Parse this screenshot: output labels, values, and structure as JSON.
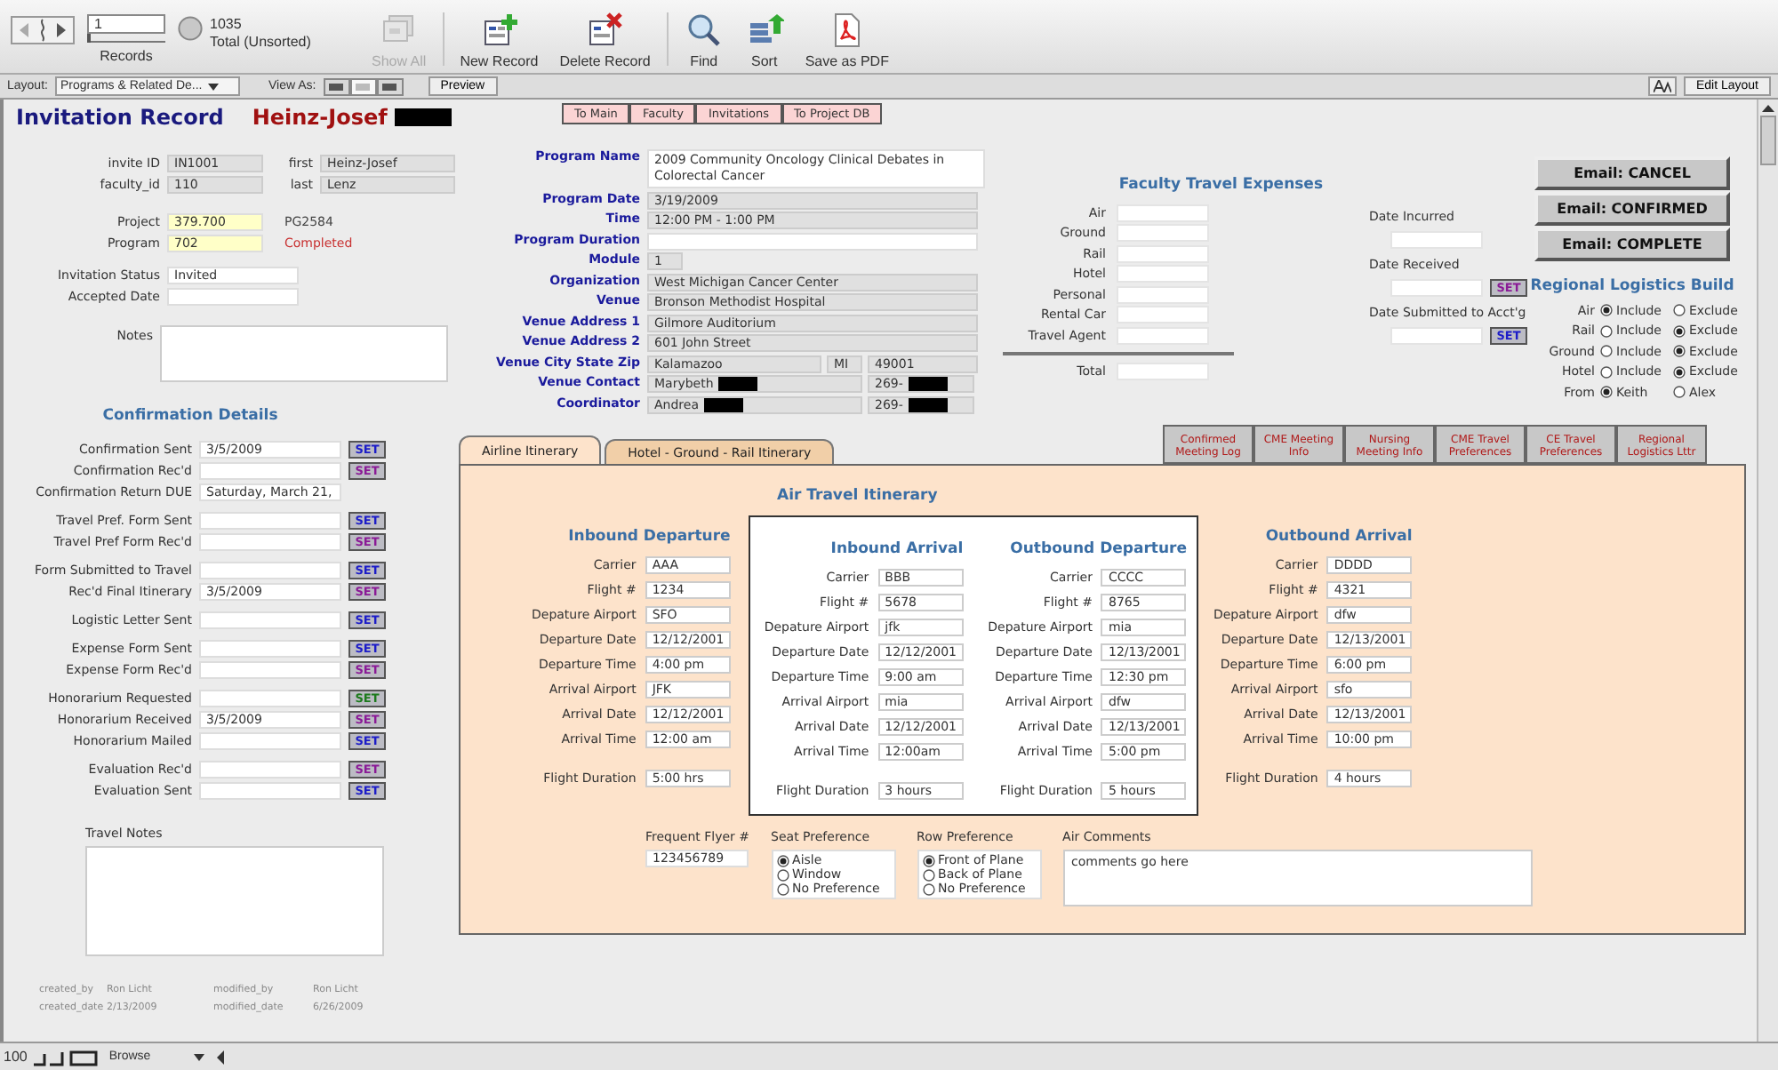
{
  "toolbar": {
    "record_number": "1",
    "record_slider": {
      "level": 0
    },
    "records_label": "Records",
    "found_count": "1035",
    "total_label": "Total (Unsorted)",
    "buttons": [
      {
        "kind": "show_all",
        "label": "Show All",
        "disabled": true
      },
      {
        "kind": "new",
        "label": "New Record",
        "disabled": false
      },
      {
        "kind": "delete",
        "label": "Delete Record",
        "disabled": false
      },
      {
        "kind": "find",
        "label": "Find",
        "disabled": false
      },
      {
        "kind": "sort",
        "label": "Sort",
        "disabled": false
      },
      {
        "kind": "pdf",
        "label": "Save as PDF",
        "disabled": false
      }
    ]
  },
  "layout_bar": {
    "layout_label": "Layout:",
    "layout_value": "Programs & Related De...",
    "view_as_label": "View As:",
    "view_modes": [
      {
        "selected": false
      },
      {
        "selected": true
      },
      {
        "selected": false
      }
    ],
    "preview_button": "Preview",
    "edit_layout_button": "Edit Layout"
  },
  "header": {
    "title": "Invitation Record",
    "name": "Heinz-Josef",
    "redacted": true
  },
  "nav_buttons": [
    "To Main",
    "Faculty",
    "Invitations",
    "To Project DB"
  ],
  "id_rows": [
    {
      "label": "invite ID",
      "value": "IN1001",
      "name_label": "first",
      "name_value": "Heinz-Josef"
    },
    {
      "label": "faculty_id",
      "value": "110",
      "name_label": "last",
      "name_value": "Lenz"
    }
  ],
  "project_rows": [
    {
      "label": "Project",
      "value": "379.700",
      "note": "PG2584",
      "alert": false
    },
    {
      "label": "Program",
      "value": "702",
      "note": "Completed",
      "alert": true
    }
  ],
  "status_rows": [
    {
      "label": "Invitation Status",
      "value": "Invited"
    },
    {
      "label": "Accepted Date"
    }
  ],
  "notes_label": "Notes",
  "confirmation": {
    "title": "Confirmation Details",
    "groups": [
      [
        {
          "label": "Confirmation Sent",
          "value": "3/5/2009",
          "set": {
            "label": "SET",
            "color": "#1c1cc8"
          }
        },
        {
          "label": "Confirmation Rec'd",
          "set": {
            "label": "SET",
            "color": "#8a1a96"
          }
        },
        {
          "label": "Confirmation Return DUE",
          "value": "Saturday, March 21,"
        }
      ],
      [
        {
          "label": "Travel Pref. Form Sent",
          "set": {
            "label": "SET",
            "color": "#1c1cc8"
          }
        },
        {
          "label": "Travel Pref Form Rec'd",
          "set": {
            "label": "SET",
            "color": "#8a1a96"
          }
        }
      ],
      [
        {
          "label": "Form Submitted to Travel",
          "set": {
            "label": "SET",
            "color": "#1c1cc8"
          }
        },
        {
          "label": "Rec'd Final Itinerary",
          "value": "3/5/2009",
          "set": {
            "label": "SET",
            "color": "#8a1a96"
          }
        }
      ],
      [
        {
          "label": "Logistic Letter Sent",
          "set": {
            "label": "SET",
            "color": "#1c1cc8"
          }
        }
      ],
      [
        {
          "label": "Expense Form Sent",
          "set": {
            "label": "SET",
            "color": "#1c1cc8"
          }
        },
        {
          "label": "Expense Form Rec'd",
          "set": {
            "label": "SET",
            "color": "#8a1a96"
          }
        }
      ],
      [
        {
          "label": "Honorarium Requested",
          "set": {
            "label": "SET",
            "color": "#1c7a1c"
          }
        },
        {
          "label": "Honorarium Received",
          "value": "3/5/2009",
          "set": {
            "label": "SET",
            "color": "#8a1a96"
          }
        },
        {
          "label": "Honorarium Mailed",
          "set": {
            "label": "SET",
            "color": "#1c1cc8"
          }
        }
      ],
      [
        {
          "label": "Evaluation Rec'd",
          "set": {
            "label": "SET",
            "color": "#8a1a96"
          }
        },
        {
          "label": "Evaluation Sent",
          "set": {
            "label": "SET",
            "color": "#1c1cc8"
          }
        }
      ]
    ]
  },
  "travel_notes_label": "Travel Notes",
  "audit": [
    {
      "label": "created_by",
      "value": "Ron Licht"
    },
    {
      "label": "modified_by",
      "value": "Ron Licht"
    },
    {
      "label": "created_date",
      "value": "2/13/2009"
    },
    {
      "label": "modified_date",
      "value": "6/26/2009"
    }
  ],
  "program_info": [
    {
      "label": "Program Name",
      "values": [
        "2009 Community Oncology Clinical Debates in Colorectal Cancer"
      ],
      "editable": true
    },
    {
      "label": "Program Date",
      "values": [
        "3/19/2009"
      ],
      "editable": false
    },
    {
      "label": "Time",
      "values": [
        "12:00 PM - 1:00 PM"
      ],
      "editable": false
    },
    {
      "label": "Program Duration",
      "editable": true
    },
    {
      "label": "Module",
      "values": [
        "1"
      ],
      "editable": false
    },
    {
      "label": "Organization",
      "values": [
        "West Michigan Cancer Center"
      ],
      "editable": false
    },
    {
      "label": "Venue",
      "values": [
        "Bronson Methodist Hospital"
      ],
      "editable": false
    },
    {
      "label": "Venue Address 1",
      "values": [
        "Gilmore Auditorium"
      ],
      "editable": false
    },
    {
      "label": "Venue Address 2",
      "values": [
        "601 John Street"
      ],
      "editable": false
    },
    {
      "label": "Venue City State Zip",
      "values": [
        "Kalamazoo",
        "MI",
        "49001"
      ],
      "editable": false
    },
    {
      "label": "Venue Contact",
      "values": [
        "Marybeth",
        "269-"
      ],
      "editable": false,
      "redacted": true
    },
    {
      "label": "Coordinator",
      "values": [
        "Andrea",
        "269-"
      ],
      "editable": false,
      "redacted": true
    }
  ],
  "travel_expenses": {
    "title": "Faculty Travel Expenses",
    "items": [
      "Air",
      "Ground",
      "Rail",
      "Hotel",
      "Personal",
      "Rental Car",
      "Travel Agent"
    ],
    "total_label": "Total",
    "dates": [
      {
        "label": "Date Incurred"
      },
      {
        "label": "Date Received",
        "set": {
          "label": "SET",
          "color": "#8a1a96"
        }
      },
      {
        "label": "Date Submitted to Acct'g",
        "set": {
          "label": "SET",
          "color": "#1c1cc8"
        }
      }
    ]
  },
  "email_buttons": [
    "Email: CANCEL",
    "Email: CONFIRMED",
    "Email: COMPLETE"
  ],
  "regional_logistics": {
    "title": "Regional Logistics Build",
    "rows": [
      {
        "label": "Air",
        "options": [
          {
            "label": "Include",
            "selected": true
          },
          {
            "label": "Exclude",
            "selected": false
          }
        ]
      },
      {
        "label": "Rail",
        "options": [
          {
            "label": "Include",
            "selected": false
          },
          {
            "label": "Exclude",
            "selected": true
          }
        ]
      },
      {
        "label": "Ground",
        "options": [
          {
            "label": "Include",
            "selected": false
          },
          {
            "label": "Exclude",
            "selected": true
          }
        ]
      },
      {
        "label": "Hotel",
        "options": [
          {
            "label": "Include",
            "selected": false
          },
          {
            "label": "Exclude",
            "selected": true
          }
        ]
      },
      {
        "label": "From",
        "options": [
          {
            "label": "Keith",
            "selected": true
          },
          {
            "label": "Alex",
            "selected": false
          }
        ]
      }
    ]
  },
  "tabs": [
    {
      "label": "Airline Itinerary",
      "selected": true
    },
    {
      "label": "Hotel - Ground - Rail Itinerary",
      "selected": false
    }
  ],
  "report_buttons": [
    "Confirmed Meeting Log",
    "CME Meeting Info",
    "Nursing Meeting Info",
    "CME Travel Preferences",
    "CE Travel Preferences",
    "Regional Logistics Lttr"
  ],
  "itinerary": {
    "title": "Air Travel Itinerary",
    "legs": [
      {
        "title": "Inbound Departure",
        "framed": false,
        "fields": [
          {
            "label": "Carrier",
            "value": "AAA"
          },
          {
            "label": "Flight #",
            "value": "1234"
          },
          {
            "label": "Depature Airport",
            "value": "SFO"
          },
          {
            "label": "Departure Date",
            "value": "12/12/2001"
          },
          {
            "label": "Departure Time",
            "value": "4:00 pm"
          },
          {
            "label": "Arrival Airport",
            "value": "JFK"
          },
          {
            "label": "Arrival Date",
            "value": "12/12/2001"
          },
          {
            "label": "Arrival Time",
            "value": "12:00 am"
          },
          {
            "label": "Flight Duration",
            "value": "5:00 hrs"
          }
        ]
      },
      {
        "title": "Inbound Arrival",
        "framed": true,
        "fields": [
          {
            "label": "Carrier",
            "value": "BBB"
          },
          {
            "label": "Flight #",
            "value": "5678"
          },
          {
            "label": "Depature Airport",
            "value": "jfk"
          },
          {
            "label": "Departure Date",
            "value": "12/12/2001"
          },
          {
            "label": "Departure Time",
            "value": "9:00 am"
          },
          {
            "label": "Arrival Airport",
            "value": "mia"
          },
          {
            "label": "Arrival Date",
            "value": "12/12/2001"
          },
          {
            "label": "Arrival Time",
            "value": "12:00am"
          },
          {
            "label": "Flight Duration",
            "value": "3 hours"
          }
        ]
      },
      {
        "title": "Outbound Departure",
        "framed": true,
        "fields": [
          {
            "label": "Carrier",
            "value": "CCCC"
          },
          {
            "label": "Flight #",
            "value": "8765"
          },
          {
            "label": "Depature Airport",
            "value": "mia"
          },
          {
            "label": "Departure Date",
            "value": "12/13/2001"
          },
          {
            "label": "Departure Time",
            "value": "12:30 pm"
          },
          {
            "label": "Arrival Airport",
            "value": "dfw"
          },
          {
            "label": "Arrival Date",
            "value": "12/13/2001"
          },
          {
            "label": "Arrival Time",
            "value": "5:00 pm"
          },
          {
            "label": "Flight Duration",
            "value": "5 hours"
          }
        ]
      },
      {
        "title": "Outbound Arrival",
        "framed": false,
        "fields": [
          {
            "label": "Carrier",
            "value": "DDDD"
          },
          {
            "label": "Flight #",
            "value": "4321"
          },
          {
            "label": "Depature Airport",
            "value": "dfw"
          },
          {
            "label": "Departure Date",
            "value": "12/13/2001"
          },
          {
            "label": "Departure Time",
            "value": "6:00 pm"
          },
          {
            "label": "Arrival Airport",
            "value": "sfo"
          },
          {
            "label": "Arrival Date",
            "value": "12/13/2001"
          },
          {
            "label": "Arrival Time",
            "value": "10:00 pm"
          },
          {
            "label": "Flight Duration",
            "value": "4 hours"
          }
        ]
      }
    ],
    "frequent_flyer": {
      "label": "Frequent Flyer #",
      "value": "123456789"
    },
    "seat_preference": {
      "label": "Seat Preference",
      "options": [
        {
          "label": "Aisle",
          "selected": true
        },
        {
          "label": "Window",
          "selected": false
        },
        {
          "label": "No Preference",
          "selected": false
        }
      ]
    },
    "row_preference": {
      "label": "Row Preference",
      "options": [
        {
          "label": "Front of Plane",
          "selected": true
        },
        {
          "label": "Back of Plane",
          "selected": false
        },
        {
          "label": "No Preference",
          "selected": false
        }
      ]
    },
    "air_comments": {
      "label": "Air Comments",
      "value": "comments go here"
    }
  },
  "status_bar": {
    "zoom": "100",
    "mode": "Browse"
  }
}
